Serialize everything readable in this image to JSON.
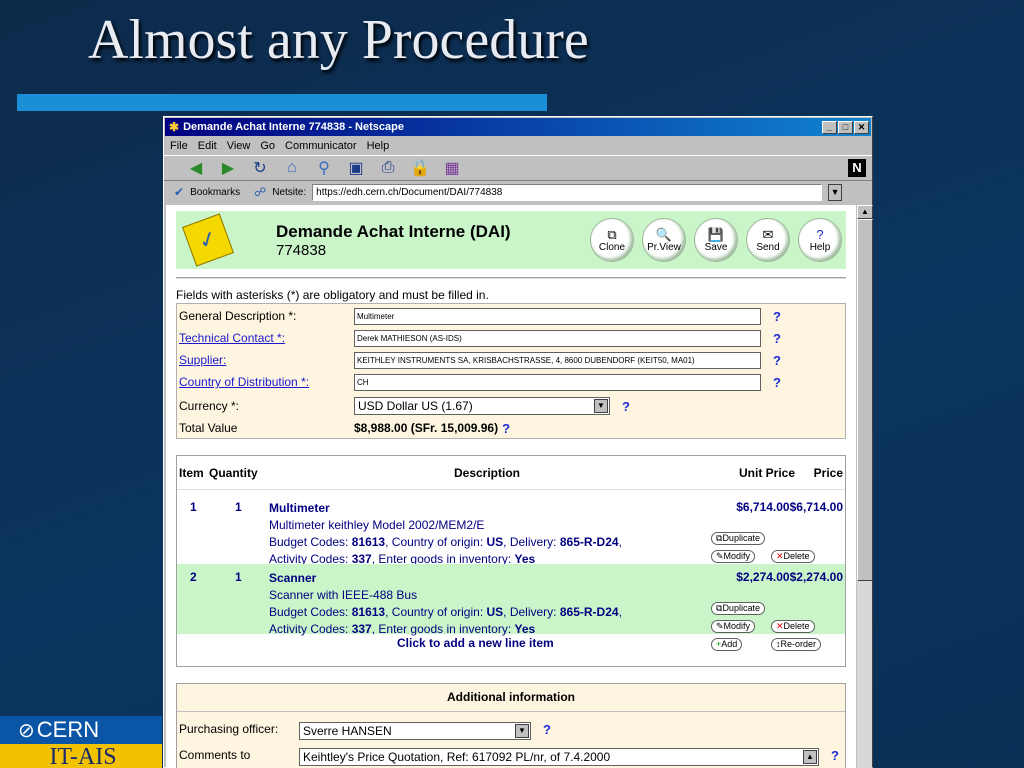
{
  "slide": {
    "title": "Almost any Procedure",
    "logo_cern": "CERN",
    "logo_itais": "IT-AIS"
  },
  "window": {
    "title": "Demande Achat Interne 774838 - Netscape",
    "menu": [
      "File",
      "Edit",
      "View",
      "Go",
      "Communicator",
      "Help"
    ],
    "bookmarks_label": "Bookmarks",
    "location_label": "Netsite:",
    "url": "https://edh.cern.ch/Document/DAI/774838"
  },
  "page": {
    "header_title": "Demande Achat Interne (DAI)",
    "doc_number": "774838",
    "actions": [
      "Clone",
      "Pr.View",
      "Save",
      "Send",
      "Help"
    ],
    "notice": "Fields with asterisks (*) are obligatory and must be filled in.",
    "fields": {
      "general_description": {
        "label": "General Description *:",
        "value": "Multimeter"
      },
      "technical_contact": {
        "label": "Technical Contact *:",
        "value": "Derek MATHIESON (AS-IDS)"
      },
      "supplier": {
        "label": "Supplier:",
        "value": "KEITHLEY INSTRUMENTS SA, KRISBACHSTRASSE, 4, 8600 DUBENDORF (KEIT50, MA01)"
      },
      "country": {
        "label": "Country of Distribution *:",
        "value": "CH"
      },
      "currency": {
        "label": "Currency *:",
        "value": "USD Dollar US (1.67)"
      },
      "total": {
        "label": "Total Value",
        "value": "$8,988.00  (SFr. 15,009.96)"
      }
    },
    "qmark": "?",
    "items": {
      "headers": {
        "item": "Item",
        "quantity": "Quantity",
        "description": "Description",
        "unit_price": "Unit Price",
        "price": "Price"
      },
      "rows": [
        {
          "num": "1",
          "qty": "1",
          "name": "Multimeter",
          "detail": "Multimeter keithley Model 2002/MEM2/E",
          "budget_label": "Budget Codes: ",
          "budget": "81613",
          "origin_label": ", Country of origin: ",
          "origin": "US",
          "delivery_label": ", Delivery: ",
          "delivery": "865-R-D24",
          "comma": ",",
          "activity_label": "Activity Codes: ",
          "activity": "337",
          "inventory_label": ", Enter goods in inventory: ",
          "inventory": "Yes",
          "unit_price": "$6,714.00",
          "price": "$6,714.00"
        },
        {
          "num": "2",
          "qty": "1",
          "name": "Scanner",
          "detail": "Scanner with IEEE-488 Bus",
          "budget_label": "Budget Codes: ",
          "budget": "81613",
          "origin_label": ", Country of origin: ",
          "origin": "US",
          "delivery_label": ", Delivery: ",
          "delivery": "865-R-D24",
          "comma": ",",
          "activity_label": "Activity Codes: ",
          "activity": "337",
          "inventory_label": ", Enter goods in inventory: ",
          "inventory": "Yes",
          "unit_price": "$2,274.00",
          "price": "$2,274.00"
        }
      ],
      "row_buttons": {
        "duplicate": "Duplicate",
        "modify": "Modify",
        "delete": "Delete"
      },
      "add_line": "Click to add a new line item",
      "add_button": "Add",
      "reorder_button": "Re-order"
    },
    "additional": {
      "title": "Additional information",
      "purchasing_label": "Purchasing officer:",
      "purchasing_value": "Sverre HANSEN",
      "comments_label": "Comments to",
      "comments_value": "Keihtley's Price Quotation, Ref: 617092 PL/nr, of 7.4.2000"
    }
  }
}
